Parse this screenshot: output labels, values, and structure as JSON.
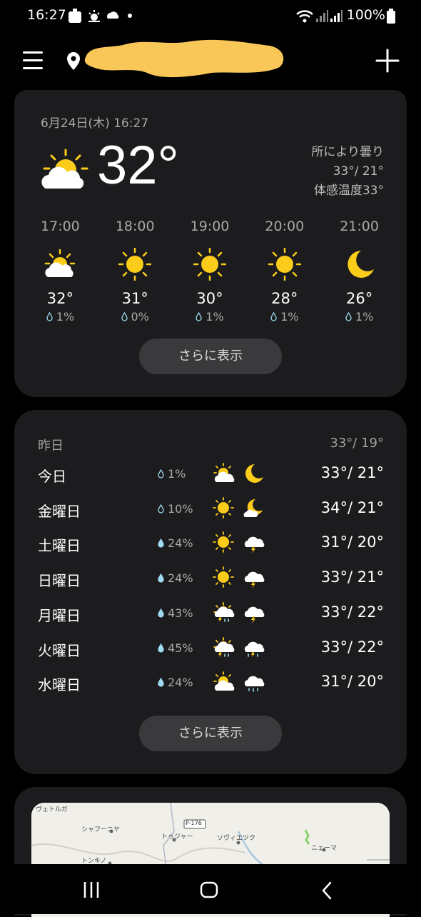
{
  "status_bar": {
    "time": "16:27",
    "battery_text": "100%"
  },
  "current": {
    "date": "6月24日(木) 16:27",
    "temperature": "32°",
    "condition": "所により曇り",
    "high_low": "33°/ 21°",
    "feels_like": "体感温度33°",
    "icon": "partly-cloudy-day-icon"
  },
  "hourly": [
    {
      "time": "17:00",
      "temp": "32°",
      "precip": "1%",
      "icon": "partly-cloudy"
    },
    {
      "time": "18:00",
      "temp": "31°",
      "precip": "0%",
      "icon": "sun"
    },
    {
      "time": "19:00",
      "temp": "30°",
      "precip": "1%",
      "icon": "sun"
    },
    {
      "time": "20:00",
      "temp": "28°",
      "precip": "1%",
      "icon": "sun"
    },
    {
      "time": "21:00",
      "temp": "26°",
      "precip": "1%",
      "icon": "moon"
    }
  ],
  "buttons": {
    "more_hourly": "さらに表示",
    "more_daily": "さらに表示"
  },
  "yesterday": {
    "label": "昨日",
    "temps": "33°/ 19°"
  },
  "daily": [
    {
      "day": "今日",
      "precip": "1%",
      "day_icon": "partly-cloudy",
      "night_icon": "moon",
      "temps": "33°/ 21°"
    },
    {
      "day": "金曜日",
      "precip": "10%",
      "day_icon": "sun",
      "night_icon": "moon-cloud",
      "temps": "34°/ 21°"
    },
    {
      "day": "土曜日",
      "precip": "24%",
      "day_icon": "sun",
      "night_icon": "thunderstorm",
      "temps": "31°/ 20°"
    },
    {
      "day": "日曜日",
      "precip": "24%",
      "day_icon": "sun",
      "night_icon": "thunderstorm",
      "temps": "33°/ 21°"
    },
    {
      "day": "月曜日",
      "precip": "43%",
      "day_icon": "sun-thunder-rain",
      "night_icon": "thunderstorm",
      "temps": "33°/ 22°"
    },
    {
      "day": "火曜日",
      "precip": "45%",
      "day_icon": "sun-thunder-rain",
      "night_icon": "thunder-rain",
      "temps": "33°/ 22°"
    },
    {
      "day": "水曜日",
      "precip": "24%",
      "day_icon": "partly-cloudy",
      "night_icon": "rain-cloud",
      "temps": "31°/ 20°"
    }
  ],
  "map": {
    "labels": [
      "ヴェトルガ",
      "シャフーニヤ",
      "トゥジャー",
      "P-176",
      "ソヴィエツク",
      "ニェーマ",
      "トンキノ"
    ]
  },
  "colors": {
    "background": "#000000",
    "card": "#1c1c1e",
    "sun": "#fccc1a",
    "cloud": "#ffffff",
    "button": "#3a3a3c",
    "blur_overlay": "#f8c757"
  }
}
